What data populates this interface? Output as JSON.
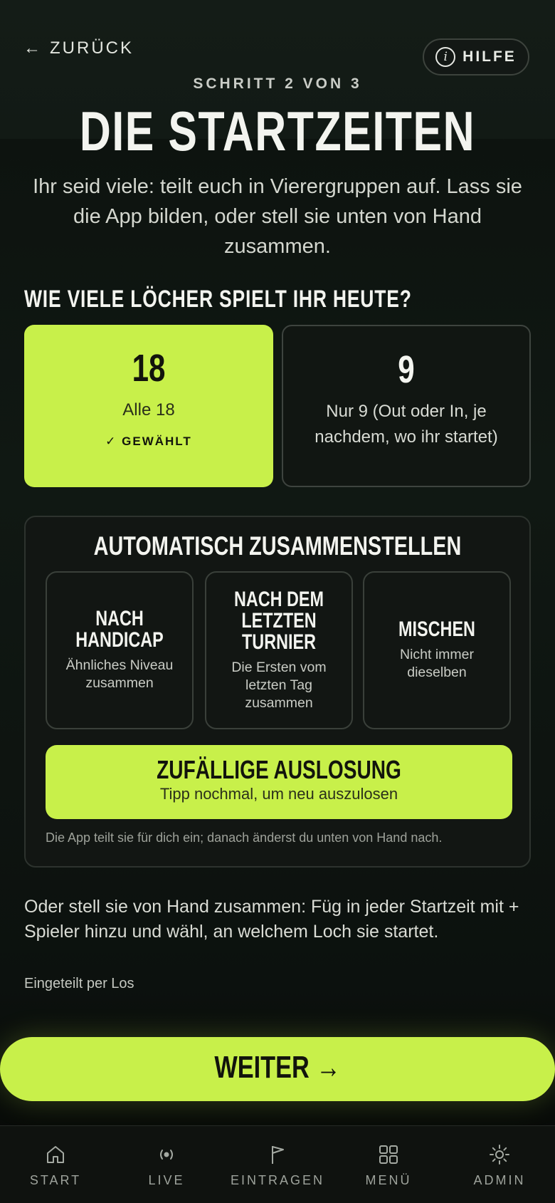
{
  "header": {
    "back_arrow": "←",
    "back_label": "ZURÜCK",
    "help_icon": "i",
    "help_label": "HILFE",
    "step": "SCHRITT 2 VON 3",
    "title": "DIE STARTZEITEN",
    "intro": "Ihr seid viele: teilt euch in Vierergruppen auf. Lass sie die App bilden, oder stell sie unten von Hand zusammen."
  },
  "holes": {
    "question": "WIE VIELE LÖCHER SPIELT IHR HEUTE?",
    "options": [
      {
        "number": "18",
        "label": "Alle 18",
        "selected_text": "✓ GEWÄHLT"
      },
      {
        "number": "9",
        "label": "Nur 9 (Out oder In, je nachdem, wo ihr startet)"
      }
    ]
  },
  "auto": {
    "title": "AUTOMATISCH ZUSAMMENSTELLEN",
    "methods": [
      {
        "title": "NACH HANDICAP",
        "subtitle": "Ähnliches Niveau zusammen"
      },
      {
        "title": "NACH DEM LETZTEN TURNIER",
        "subtitle": "Die Ersten vom letzten Tag zusammen"
      },
      {
        "title": "MISCHEN",
        "subtitle": "Nicht immer dieselben"
      }
    ],
    "random_title": "ZUFÄLLIGE AUSLOSUNG",
    "random_sub": "Tipp nochmal, um neu auszulosen",
    "note": "Die App teilt sie für dich ein; danach änderst du unten von Hand nach."
  },
  "manual_text": "Oder stell sie von Hand zusammen: Füg in jeder Startzeit mit + Spieler hinzu und wähl, an welchem Loch sie startet.",
  "status_text": "Eingeteilt per Los",
  "continue_label": "WEITER →",
  "nav": [
    {
      "label": "START",
      "icon": "home-icon"
    },
    {
      "label": "LIVE",
      "icon": "live-icon"
    },
    {
      "label": "EINTRAGEN",
      "icon": "flag-icon"
    },
    {
      "label": "MENÜ",
      "icon": "grid-icon"
    },
    {
      "label": "ADMIN",
      "icon": "sun-gear-icon"
    }
  ],
  "colors": {
    "accent": "#c8f04a",
    "background": "#0f1612"
  }
}
